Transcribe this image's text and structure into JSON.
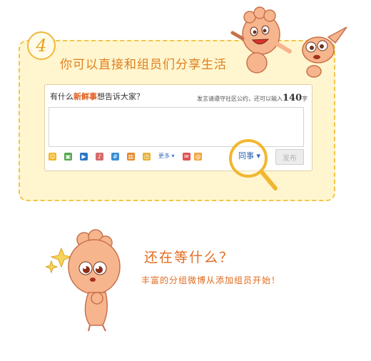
{
  "step": {
    "number": "4",
    "title": "你可以直接和组员们分享生活"
  },
  "compose": {
    "prompt_prefix": "有什么",
    "prompt_highlight": "新鲜事",
    "prompt_suffix": "想告诉大家？",
    "notice_prefix": "发言请遵守社区公约，还可以输入",
    "char_limit": "140",
    "notice_suffix": "字",
    "toolbar_more": "更多",
    "visibility_label": "同事",
    "publish_label": "发布"
  },
  "toolbar_icons": [
    {
      "name": "emoji-icon",
      "color": "#f5b526"
    },
    {
      "name": "image-icon",
      "color": "#55a84e"
    },
    {
      "name": "video-icon",
      "color": "#2c77c8"
    },
    {
      "name": "music-icon",
      "color": "#d76b6b"
    },
    {
      "name": "topic-icon",
      "color": "#3a8ed4"
    },
    {
      "name": "poll-icon",
      "color": "#e6892b"
    },
    {
      "name": "schedule-icon",
      "color": "#e7b23b"
    }
  ],
  "toolbar_more_icons": [
    {
      "name": "photo-album-icon",
      "color": "#e05252"
    },
    {
      "name": "at-icon",
      "color": "#f0a43a"
    }
  ],
  "cta": {
    "title": "还在等什么？",
    "subtitle": "丰富的分组微博从添加组员开始！"
  },
  "colors": {
    "accent_orange": "#e26a1d",
    "card_background": "#fff6cf",
    "card_border": "#f2c54a",
    "link_blue": "#2f64b8"
  }
}
